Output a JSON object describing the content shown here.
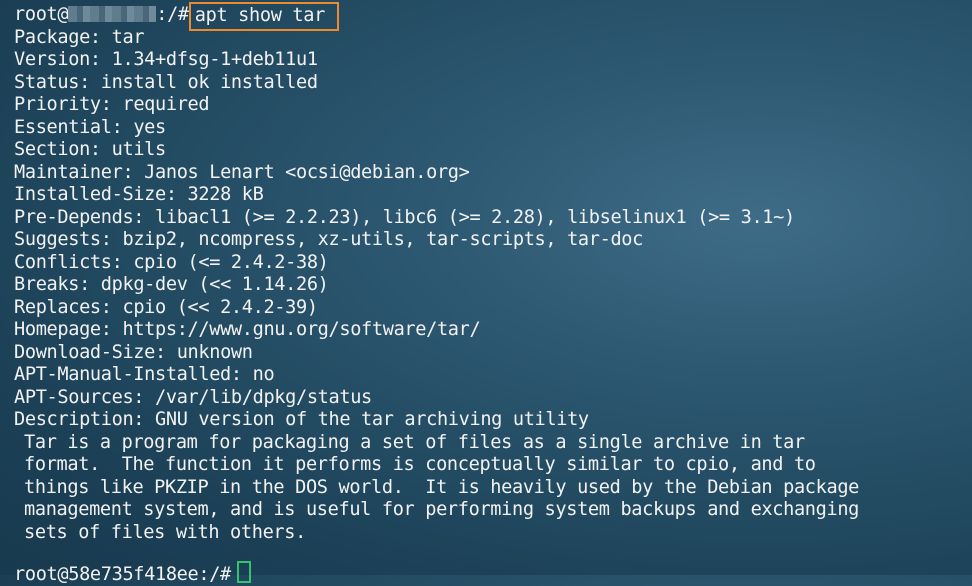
{
  "prompt": {
    "user": "root@",
    "suffix": ":/#",
    "command": "apt show tar"
  },
  "fields": [
    {
      "key": "Package",
      "value": "tar"
    },
    {
      "key": "Version",
      "value": "1.34+dfsg-1+deb11u1"
    },
    {
      "key": "Status",
      "value": "install ok installed"
    },
    {
      "key": "Priority",
      "value": "required"
    },
    {
      "key": "Essential",
      "value": "yes"
    },
    {
      "key": "Section",
      "value": "utils"
    },
    {
      "key": "Maintainer",
      "value": "Janos Lenart <ocsi@debian.org>"
    },
    {
      "key": "Installed-Size",
      "value": "3228 kB"
    },
    {
      "key": "Pre-Depends",
      "value": "libacl1 (>= 2.2.23), libc6 (>= 2.28), libselinux1 (>= 3.1~)"
    },
    {
      "key": "Suggests",
      "value": "bzip2, ncompress, xz-utils, tar-scripts, tar-doc"
    },
    {
      "key": "Conflicts",
      "value": "cpio (<= 2.4.2-38)"
    },
    {
      "key": "Breaks",
      "value": "dpkg-dev (<< 1.14.26)"
    },
    {
      "key": "Replaces",
      "value": "cpio (<< 2.4.2-39)"
    },
    {
      "key": "Homepage",
      "value": "https://www.gnu.org/software/tar/"
    },
    {
      "key": "Download-Size",
      "value": "unknown"
    },
    {
      "key": "APT-Manual-Installed",
      "value": "no"
    },
    {
      "key": "APT-Sources",
      "value": "/var/lib/dpkg/status"
    },
    {
      "key": "Description",
      "value": "GNU version of the tar archiving utility"
    }
  ],
  "description_lines": [
    "Tar is a program for packaging a set of files as a single archive in tar",
    "format.  The function it performs is conceptually similar to cpio, and to",
    "things like PKZIP in the DOS world.  It is heavily used by the Debian package",
    "management system, and is useful for performing system backups and exchanging",
    "sets of files with others."
  ],
  "bottom_prompt": "root@58e735f418ee:/#",
  "colors": {
    "text": "#f2f2f2",
    "command_highlight_border": "#ef8a2c",
    "cursor": "#34c26e",
    "background": "#234c63"
  }
}
